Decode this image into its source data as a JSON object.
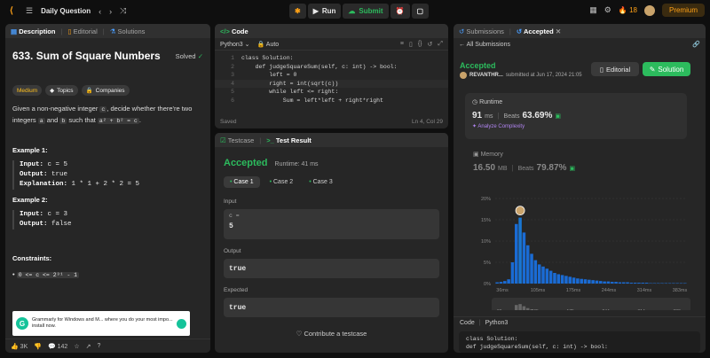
{
  "topbar": {
    "title": "Daily Question",
    "run": "Run",
    "submit": "Submit",
    "streak": "18",
    "premium": "Premium"
  },
  "left": {
    "tabs": [
      "Description",
      "Editorial",
      "Solutions"
    ],
    "title": "633. Sum of Square Numbers",
    "solved": "Solved",
    "chips": [
      "Medium",
      "Topics",
      "Companies"
    ],
    "desc_1": "Given a non-negative integer",
    "desc_c": "c",
    "desc_2": ", decide whether there're two integers",
    "desc_a": "a",
    "desc_and": "and",
    "desc_b": "b",
    "desc_3": "such that",
    "desc_eq": "a² + b² = c",
    "desc_end": ".",
    "ex1_title": "Example 1:",
    "ex1_input_label": "Input:",
    "ex1_input": "c = 5",
    "ex1_output_label": "Output:",
    "ex1_output": "true",
    "ex1_expl_label": "Explanation:",
    "ex1_expl": "1 * 1 + 2 * 2 = 5",
    "ex2_title": "Example 2:",
    "ex2_input_label": "Input:",
    "ex2_input": "c = 3",
    "ex2_output_label": "Output:",
    "ex2_output": "false",
    "constraints_title": "Constraints:",
    "constraint": "0 <= c <= 2³¹ - 1",
    "ad_text": "Grammarly for Windows and M... where you do your most impo... install now.",
    "likes": "3K",
    "comments": "142"
  },
  "code": {
    "tab": "Code",
    "lang": "Python3",
    "auto": "Auto",
    "saved": "Saved",
    "cursor": "Ln 4, Col 29",
    "lines": [
      {
        "n": "1",
        "t": "class Solution:"
      },
      {
        "n": "2",
        "t": "    def judgeSquareSum(self, c: int) -> bool:"
      },
      {
        "n": "3",
        "t": "        left = 0"
      },
      {
        "n": "4",
        "t": "        right = int(sqrt(c))"
      },
      {
        "n": "5",
        "t": "        while left <= right:"
      },
      {
        "n": "6",
        "t": "            Sum = left*left + right*right"
      }
    ]
  },
  "result": {
    "tabs": [
      "Testcase",
      "Test Result"
    ],
    "status": "Accepted",
    "runtime": "Runtime: 41 ms",
    "cases": [
      "Case 1",
      "Case 2",
      "Case 3"
    ],
    "input_label": "Input",
    "var": "c =",
    "input_val": "5",
    "output_label": "Output",
    "output_val": "true",
    "expected_label": "Expected",
    "expected_val": "true",
    "contribute": "Contribute a testcase"
  },
  "right": {
    "tabs": [
      "Submissions",
      "Accepted"
    ],
    "back": "All Submissions",
    "status": "Accepted",
    "user": "REVANTHR...",
    "submitted": "submitted at Jun 17, 2024 21:05",
    "editorial": "Editorial",
    "solution": "Solution",
    "runtime_label": "Runtime",
    "runtime_val": "91",
    "runtime_unit": "ms",
    "beats": "Beats",
    "runtime_beats": "63.69%",
    "analyze": "Analyze Complexity",
    "memory_label": "Memory",
    "memory_val": "16.50",
    "memory_unit": "MB",
    "memory_beats": "79.87%",
    "code_label": "Code",
    "code_lang": "Python3",
    "code_lines": [
      "class Solution:",
      "    def judgeSquareSum(self, c: int) -> bool:"
    ]
  },
  "chart_data": {
    "type": "bar",
    "ylabels": [
      "20%",
      "15%",
      "10%",
      "5%",
      "0%"
    ],
    "ylim": [
      0,
      20
    ],
    "xlabels": [
      "36ms",
      "105ms",
      "175ms",
      "244ms",
      "314ms",
      "383ms"
    ],
    "values": [
      0.3,
      0.4,
      0.6,
      1,
      5,
      14,
      15.5,
      12,
      9,
      7,
      5.5,
      4.5,
      4,
      3.5,
      3,
      2.5,
      2.2,
      2,
      1.8,
      1.6,
      1.4,
      1.2,
      1.1,
      1,
      0.9,
      0.8,
      0.7,
      0.6,
      0.5,
      0.5,
      0.4,
      0.4,
      0.3,
      0.3,
      0.3,
      0.2,
      0.2,
      0.2,
      0.2,
      0.2,
      0.1,
      0.1,
      0.1,
      0.1,
      0.1,
      0.1,
      0.1,
      0.1,
      0.1,
      0.1
    ],
    "highlight": 6,
    "colors": {
      "bar": "#1a73e8",
      "highlight": "#1976d2"
    }
  }
}
